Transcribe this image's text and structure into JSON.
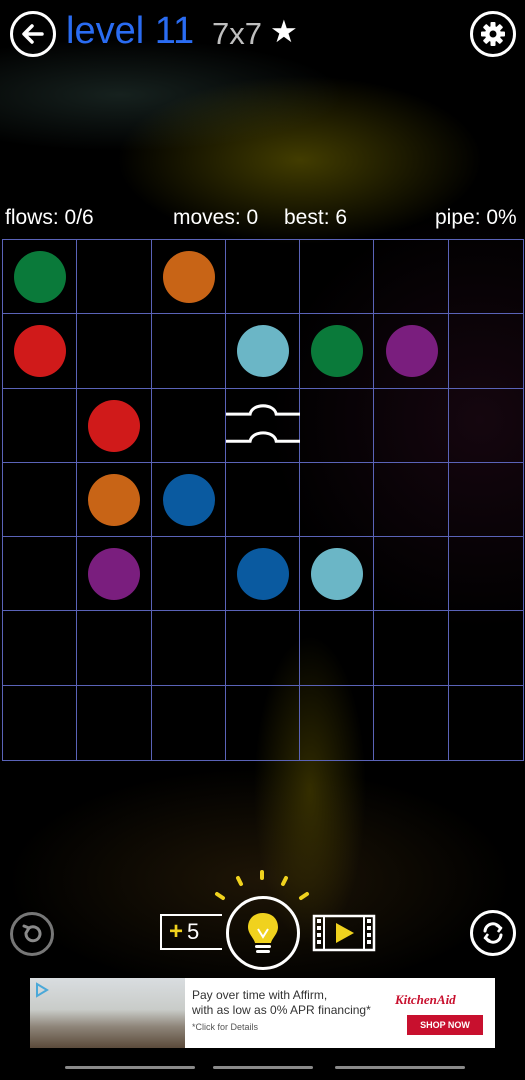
{
  "header": {
    "back_icon": "arrow-left-icon",
    "level_title": "level 11",
    "level_size": "7x7",
    "star": "★",
    "settings_icon": "gear-icon"
  },
  "stats": {
    "flows": "flows: 0/6",
    "moves": "moves: 0",
    "best": "best: 6",
    "pipe": "pipe: 0%"
  },
  "board": {
    "rows": 7,
    "cols": 7,
    "grid_color": "#5a63b8",
    "dots": [
      {
        "row": 0,
        "col": 0,
        "color": "green"
      },
      {
        "row": 0,
        "col": 2,
        "color": "orange"
      },
      {
        "row": 1,
        "col": 0,
        "color": "red"
      },
      {
        "row": 1,
        "col": 3,
        "color": "cyan"
      },
      {
        "row": 1,
        "col": 4,
        "color": "green"
      },
      {
        "row": 1,
        "col": 5,
        "color": "purple"
      },
      {
        "row": 2,
        "col": 1,
        "color": "red"
      },
      {
        "row": 3,
        "col": 1,
        "color": "orange"
      },
      {
        "row": 3,
        "col": 2,
        "color": "blue"
      },
      {
        "row": 4,
        "col": 1,
        "color": "purple"
      },
      {
        "row": 4,
        "col": 3,
        "color": "blue"
      },
      {
        "row": 4,
        "col": 4,
        "color": "cyan"
      }
    ],
    "bridge": {
      "row": 2,
      "col": 3
    },
    "colors": {
      "green": "#0a7a3a",
      "orange": "#c86416",
      "red": "#d01a1a",
      "cyan": "#6bb6c6",
      "purple": "#7a1e7e",
      "blue": "#0a5aa0"
    }
  },
  "controls": {
    "undo_icon": "undo-icon",
    "hint_count": "5",
    "hint_plus": "+",
    "hint_icon": "lightbulb-icon",
    "video_icon": "film-play-icon",
    "restart_icon": "restart-icon"
  },
  "ad": {
    "text_line1": "Pay over time with Affirm,",
    "text_line2": "with as low as 0% APR financing*",
    "small": "*Click for Details",
    "brand": "KitchenAid",
    "cta": "SHOP NOW",
    "adchoices_icon": "adchoices-icon"
  }
}
